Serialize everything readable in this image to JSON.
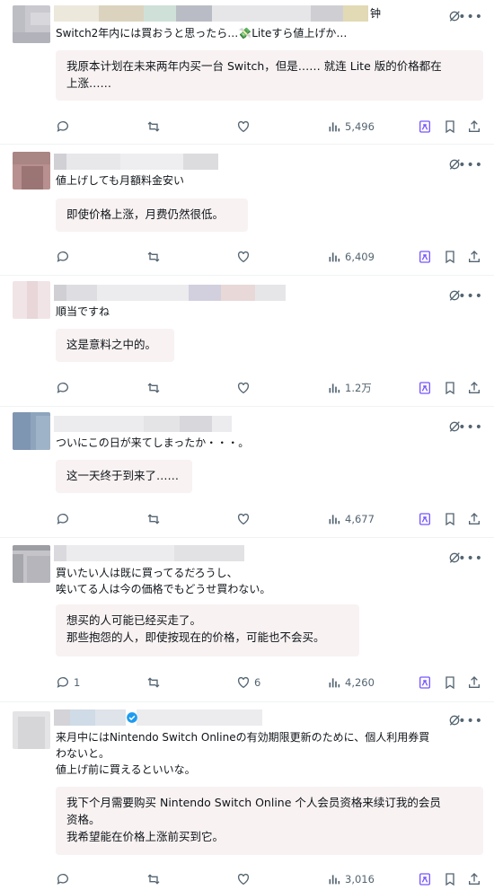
{
  "colors": {
    "text": "#0f1419",
    "muted": "#536471",
    "accent": "#7856ff",
    "translation_bg": "#f8f2f2",
    "divider": "#eff3f4"
  },
  "posts": [
    {
      "name_suffix": "钟",
      "original": "Switch2年内には買おうと思ったら…💸Liteすら値上げか…",
      "translation": "我原本计划在未来两年内买一台 Switch，但是…… 就连 Lite 版的价格都在\n上涨……",
      "replies": "",
      "retweets": "",
      "likes": "",
      "views": "5,496"
    },
    {
      "name_suffix": "",
      "original": "値上げしても月額料金安い",
      "translation": "即使价格上涨，月费仍然很低。",
      "replies": "",
      "retweets": "",
      "likes": "",
      "views": "6,409"
    },
    {
      "name_suffix": "",
      "original": "順当ですね",
      "translation": "这是意料之中的。",
      "replies": "",
      "retweets": "",
      "likes": "",
      "views": "1.2万"
    },
    {
      "name_suffix": "",
      "original": "ついにこの日が来てしまったか・・・。",
      "translation": "这一天终于到来了……",
      "replies": "",
      "retweets": "",
      "likes": "",
      "views": "4,677"
    },
    {
      "name_suffix": "",
      "original": "買いたい人は既に買ってるだろうし、\n唉いてる人は今の価格でもどうせ買わない。",
      "translation": "想买的人可能已经买走了。\n那些抱怨的人，即使按现在的价格，可能也不会买。",
      "replies": "1",
      "retweets": "",
      "likes": "6",
      "views": "4,260"
    },
    {
      "name_suffix": "",
      "original": "来月中にはNintendo Switch Onlineの有効期限更新のために、個人利用券買\nわないと。\n値上げ前に買えるといいな。",
      "translation": "我下个月需要购买 Nintendo Switch Online 个人会员资格来续订我的会员\n资格。\n我希望能在价格上涨前买到它。",
      "replies": "",
      "retweets": "",
      "likes": "",
      "views": "3,016"
    }
  ],
  "icons": {
    "reply": "reply-icon",
    "retweet": "retweet-icon",
    "like": "heart-icon",
    "views": "views-chart-icon",
    "grok": "grok-icon",
    "bookmark": "bookmark-icon",
    "share": "share-icon",
    "more": "more-icon",
    "verified": "verified-badge-icon"
  }
}
